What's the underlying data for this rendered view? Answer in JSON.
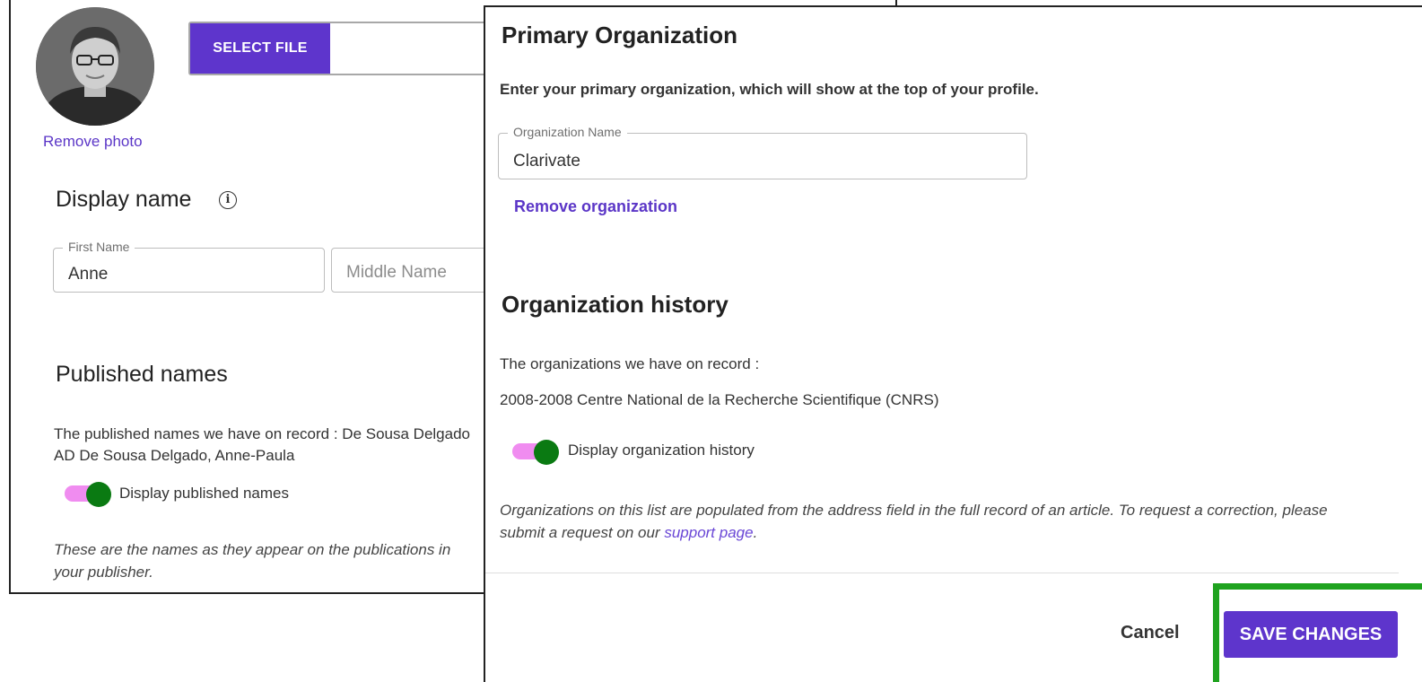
{
  "profile": {
    "remove_photo": "Remove photo",
    "select_file": "SELECT FILE"
  },
  "display_name": {
    "title": "Display name",
    "info_icon": "i",
    "first_name_label": "First Name",
    "first_name_value": "Anne",
    "middle_name_placeholder": "Middle Name"
  },
  "published_names": {
    "title": "Published names",
    "record_line_1": "The published names we have on record :   De Sousa Delgado",
    "record_line_2": "AD   De Sousa Delgado, Anne-Paula",
    "toggle_label": "Display published names",
    "toggle_on": true,
    "note": "These are the names as they appear on the publications in your publisher."
  },
  "modal": {
    "title": "Primary Organization",
    "description": "Enter your primary organization, which will show at the top of your profile.",
    "org_label": "Organization Name",
    "org_value": "Clarivate",
    "remove_org": "Remove organization",
    "history_title": "Organization history",
    "history_intro": "The organizations we have on record :",
    "history_entry": "2008-2008 Centre National de la Recherche Scientifique (CNRS)",
    "history_toggle_label": "Display organization history",
    "history_toggle_on": true,
    "note_prefix": "Organizations on this list are populated from the address field in the full record of an article. To request a correction, please submit a request on our ",
    "note_link": "support page",
    "note_suffix": ".",
    "cancel": "Cancel",
    "save": "SAVE CHANGES"
  },
  "colors": {
    "accent": "#5e35cc",
    "link": "#5b36c7",
    "toggle_track": "#f08cf0",
    "toggle_thumb": "#0a7a12",
    "highlight": "#1fa31f"
  }
}
